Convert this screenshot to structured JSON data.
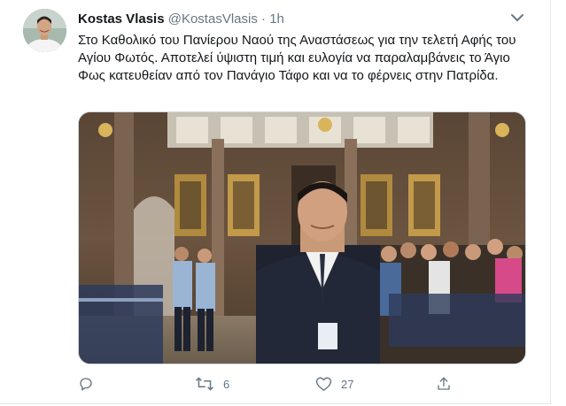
{
  "tweet": {
    "author_name": "Kostas Vlasis",
    "handle": "@KostasVlasis",
    "separator": "·",
    "time": "1h",
    "text": "Στο Καθολικό του Πανίερου Ναού της Αναστάσεως για την τελετή Αφής του Αγίου Φωτός. Αποτελεί ύψιστη τιμή και ευλογία να παραλαμβάνεις το Άγιο Φως κατευθείαν από τον Πανάγιο Τάφο και να το φέρνεις στην Πατρίδα."
  },
  "actions": {
    "reply_count": "",
    "retweet_count": "6",
    "like_count": "27"
  },
  "icons": {
    "more": "chevron-down-icon",
    "reply": "reply-icon",
    "retweet": "retweet-icon",
    "like": "heart-icon",
    "share": "share-icon"
  },
  "colors": {
    "text": "#14171a",
    "muted": "#657786",
    "border": "#e1e8ed"
  }
}
